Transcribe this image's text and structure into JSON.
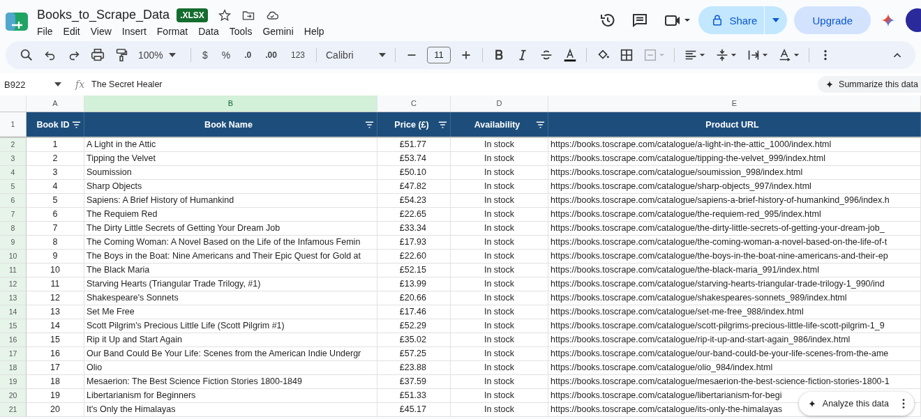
{
  "document": {
    "title": "Books_to_Scrape_Data",
    "badge": ".XLSX"
  },
  "menu": [
    "File",
    "Edit",
    "View",
    "Insert",
    "Format",
    "Data",
    "Tools",
    "Gemini",
    "Help"
  ],
  "share_button": "Share",
  "upgrade_button": "Upgrade",
  "toolbar": {
    "zoom": "100%",
    "currency": "$",
    "percent": "%",
    "decrease_decimals": ".0",
    "increase_decimals": ".00",
    "number_format": "123",
    "font": "Calibri",
    "font_size": "11"
  },
  "formula_bar": {
    "cell_ref": "B922",
    "fx": "fx",
    "value": "The Secret Healer",
    "summarize": "Summarize this data"
  },
  "columns": [
    {
      "letter": "A",
      "selected": false
    },
    {
      "letter": "B",
      "selected": true
    },
    {
      "letter": "C",
      "selected": false
    },
    {
      "letter": "D",
      "selected": false
    },
    {
      "letter": "E",
      "selected": false
    }
  ],
  "header": {
    "row_number": "1",
    "cells": [
      {
        "label": "Book ID",
        "filter": true
      },
      {
        "label": "Book Name",
        "filter": true
      },
      {
        "label": "Price (£)",
        "filter": true
      },
      {
        "label": "Availability",
        "filter": true
      },
      {
        "label": "Product URL",
        "filter": false
      }
    ]
  },
  "rows": [
    {
      "number": "2",
      "cells": [
        "1",
        "A Light in the Attic",
        "£51.77",
        "In stock",
        "https://books.toscrape.com/catalogue/a-light-in-the-attic_1000/index.html"
      ]
    },
    {
      "number": "3",
      "cells": [
        "2",
        "Tipping the Velvet",
        "£53.74",
        "In stock",
        "https://books.toscrape.com/catalogue/tipping-the-velvet_999/index.html"
      ]
    },
    {
      "number": "4",
      "cells": [
        "3",
        "Soumission",
        "£50.10",
        "In stock",
        "https://books.toscrape.com/catalogue/soumission_998/index.html"
      ]
    },
    {
      "number": "5",
      "cells": [
        "4",
        "Sharp Objects",
        "£47.82",
        "In stock",
        "https://books.toscrape.com/catalogue/sharp-objects_997/index.html"
      ]
    },
    {
      "number": "6",
      "cells": [
        "5",
        "Sapiens: A Brief History of Humankind",
        "£54.23",
        "In stock",
        "https://books.toscrape.com/catalogue/sapiens-a-brief-history-of-humankind_996/index.h"
      ]
    },
    {
      "number": "7",
      "cells": [
        "6",
        "The Requiem Red",
        "£22.65",
        "In stock",
        "https://books.toscrape.com/catalogue/the-requiem-red_995/index.html"
      ]
    },
    {
      "number": "8",
      "cells": [
        "7",
        "The Dirty Little Secrets of Getting Your Dream Job",
        "£33.34",
        "In stock",
        "https://books.toscrape.com/catalogue/the-dirty-little-secrets-of-getting-your-dream-job_"
      ]
    },
    {
      "number": "9",
      "cells": [
        "8",
        "The Coming Woman: A Novel Based on the Life of the Infamous Femin",
        "£17.93",
        "In stock",
        "https://books.toscrape.com/catalogue/the-coming-woman-a-novel-based-on-the-life-of-t"
      ]
    },
    {
      "number": "10",
      "cells": [
        "9",
        "The Boys in the Boat: Nine Americans and Their Epic Quest for Gold at",
        "£22.60",
        "In stock",
        "https://books.toscrape.com/catalogue/the-boys-in-the-boat-nine-americans-and-their-ep"
      ]
    },
    {
      "number": "11",
      "cells": [
        "10",
        "The Black Maria",
        "£52.15",
        "In stock",
        "https://books.toscrape.com/catalogue/the-black-maria_991/index.html"
      ]
    },
    {
      "number": "12",
      "cells": [
        "11",
        "Starving Hearts (Triangular Trade Trilogy, #1)",
        "£13.99",
        "In stock",
        "https://books.toscrape.com/catalogue/starving-hearts-triangular-trade-trilogy-1_990/ind"
      ]
    },
    {
      "number": "13",
      "cells": [
        "12",
        "Shakespeare's Sonnets",
        "£20.66",
        "In stock",
        "https://books.toscrape.com/catalogue/shakespeares-sonnets_989/index.html"
      ]
    },
    {
      "number": "14",
      "cells": [
        "13",
        "Set Me Free",
        "£17.46",
        "In stock",
        "https://books.toscrape.com/catalogue/set-me-free_988/index.html"
      ]
    },
    {
      "number": "15",
      "cells": [
        "14",
        "Scott Pilgrim's Precious Little Life (Scott Pilgrim #1)",
        "£52.29",
        "In stock",
        "https://books.toscrape.com/catalogue/scott-pilgrims-precious-little-life-scott-pilgrim-1_9"
      ]
    },
    {
      "number": "16",
      "cells": [
        "15",
        "Rip it Up and Start Again",
        "£35.02",
        "In stock",
        "https://books.toscrape.com/catalogue/rip-it-up-and-start-again_986/index.html"
      ]
    },
    {
      "number": "17",
      "cells": [
        "16",
        "Our Band Could Be Your Life: Scenes from the American Indie Undergr",
        "£57.25",
        "In stock",
        "https://books.toscrape.com/catalogue/our-band-could-be-your-life-scenes-from-the-ame"
      ]
    },
    {
      "number": "18",
      "cells": [
        "17",
        "Olio",
        "£23.88",
        "In stock",
        "https://books.toscrape.com/catalogue/olio_984/index.html"
      ]
    },
    {
      "number": "19",
      "cells": [
        "18",
        "Mesaerion: The Best Science Fiction Stories 1800-1849",
        "£37.59",
        "In stock",
        "https://books.toscrape.com/catalogue/mesaerion-the-best-science-fiction-stories-1800-1"
      ]
    },
    {
      "number": "20",
      "cells": [
        "19",
        "Libertarianism for Beginners",
        "£51.33",
        "In stock",
        "https://books.toscrape.com/catalogue/libertarianism-for-begi"
      ]
    },
    {
      "number": "21",
      "cells": [
        "20",
        "It's Only the Himalayas",
        "£45.17",
        "In stock",
        "https://books.toscrape.com/catalogue/its-only-the-himalayas"
      ]
    }
  ],
  "analyze_chip": "Analyze this data"
}
